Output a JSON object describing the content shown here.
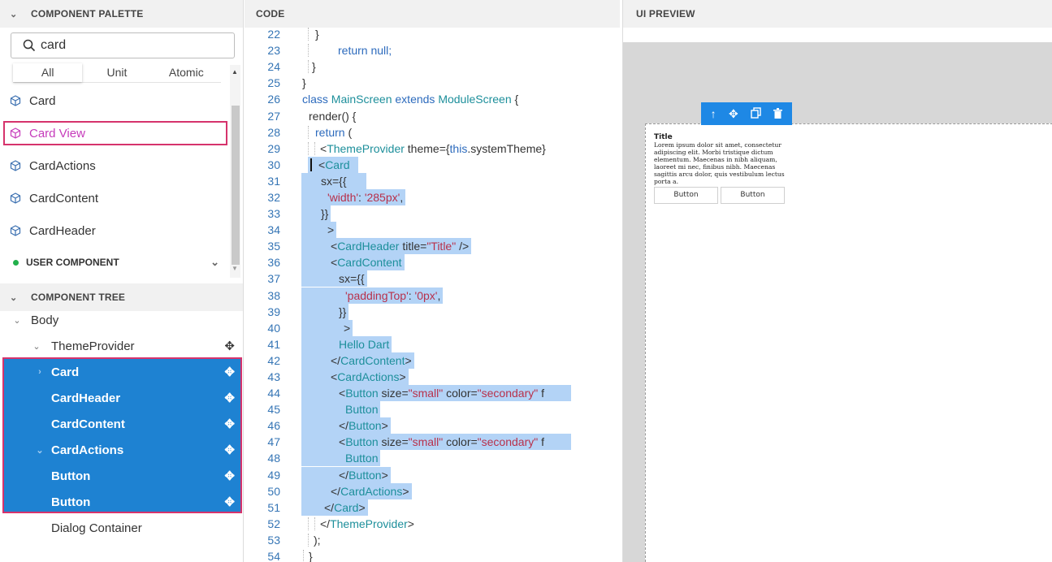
{
  "palette": {
    "header": "COMPONENT PALETTE",
    "search_value": "card",
    "tabs": [
      "All",
      "Unit",
      "Atomic"
    ],
    "items": [
      "Card",
      "Card View",
      "CardActions",
      "CardContent",
      "CardHeader"
    ],
    "user_component": "USER COMPONENT"
  },
  "tree": {
    "header": "COMPONENT TREE",
    "items": [
      "Body",
      "ThemeProvider",
      "Card",
      "CardHeader",
      "CardContent",
      "CardActions",
      "Button",
      "Button",
      "Dialog Container"
    ]
  },
  "code": {
    "header": "CODE",
    "line_numbers": [
      "22",
      "23",
      "24",
      "25",
      "26",
      "27",
      "28",
      "29",
      "30",
      "31",
      "32",
      "33",
      "34",
      "35",
      "36",
      "37",
      "38",
      "39",
      "40",
      "41",
      "42",
      "43",
      "44",
      "45",
      "46",
      "47",
      "48",
      "49",
      "50",
      "51",
      "52",
      "53",
      "54"
    ],
    "t22": "}",
    "t23_kw": "return",
    "t23_rest": " null;",
    "t24": "}",
    "t25": "}",
    "t26_kw1": "class",
    "t26_name": " MainScreen ",
    "t26_kw2": "extends",
    "t26_base": " ModuleScreen",
    "t26_end": " {",
    "t27": "render() {",
    "t28_kw": "return",
    "t28_rest": " (",
    "t29_open": "<",
    "t29_tag": "ThemeProvider",
    "t29_attr": " theme={",
    "t29_this": "this",
    "t29_end": ".systemTheme}",
    "t30_open": "<",
    "t30_tag": "Card",
    "t31": "sx={{",
    "t32_str": "'width'",
    "t32_colon": ": ",
    "t32_val": "'285px'",
    "t32_end": ",",
    "t33": "}}",
    "t34": ">",
    "t35_open": "<",
    "t35_tag": "CardHeader",
    "t35_attr": " title=",
    "t35_val": "\"Title\"",
    "t35_end": " />",
    "t36_open": "<",
    "t36_tag": "CardContent",
    "t37": "sx={{",
    "t38_str": "'paddingTop'",
    "t38_colon": ": ",
    "t38_val": "'0px'",
    "t38_end": ",",
    "t39": "}}",
    "t40": ">",
    "t41": "Hello Dart",
    "t42_open": "</",
    "t42_tag": "CardContent",
    "t42_end": ">",
    "t43_open": "<",
    "t43_tag": "CardActions",
    "t43_end": ">",
    "t44_open": "<",
    "t44_tag": "Button",
    "t44_attr1": " size=",
    "t44_val1": "\"small\"",
    "t44_attr2": " color=",
    "t44_val2": "\"secondary\"",
    "t44_end": " f",
    "t45": "Button",
    "t46_open": "</",
    "t46_tag": "Button",
    "t46_end": ">",
    "t47_open": "<",
    "t47_tag": "Button",
    "t47_attr1": " size=",
    "t47_val1": "\"small\"",
    "t47_attr2": " color=",
    "t47_val2": "\"secondary\"",
    "t47_end": " f",
    "t48": "Button",
    "t49_open": "</",
    "t49_tag": "Button",
    "t49_end": ">",
    "t50_open": "</",
    "t50_tag": "CardActions",
    "t50_end": ">",
    "t51_open": "</",
    "t51_tag": "Card",
    "t51_end": ">",
    "t52_open": "</",
    "t52_tag": "ThemeProvider",
    "t52_end": ">",
    "t53": ");",
    "t54": "}"
  },
  "preview": {
    "header": "UI PREVIEW",
    "card_title": "Title",
    "card_body": "Lorem ipsum dolor sit amet, consectetur adipiscing elit. Morbi tristique dictum elementum. Maecenas in nibh aliquam, laoreet mi nec, finibus nibh. Maecenas sagittis arcu dolor, quis vestibulum lectus porta a.",
    "button1": "Button",
    "button2": "Button"
  },
  "colors": {
    "selection": "#1e82d2",
    "highlight_border": "#d6336c",
    "code_highlight": "#b3d3f6",
    "toolbar": "#1e88e5"
  }
}
